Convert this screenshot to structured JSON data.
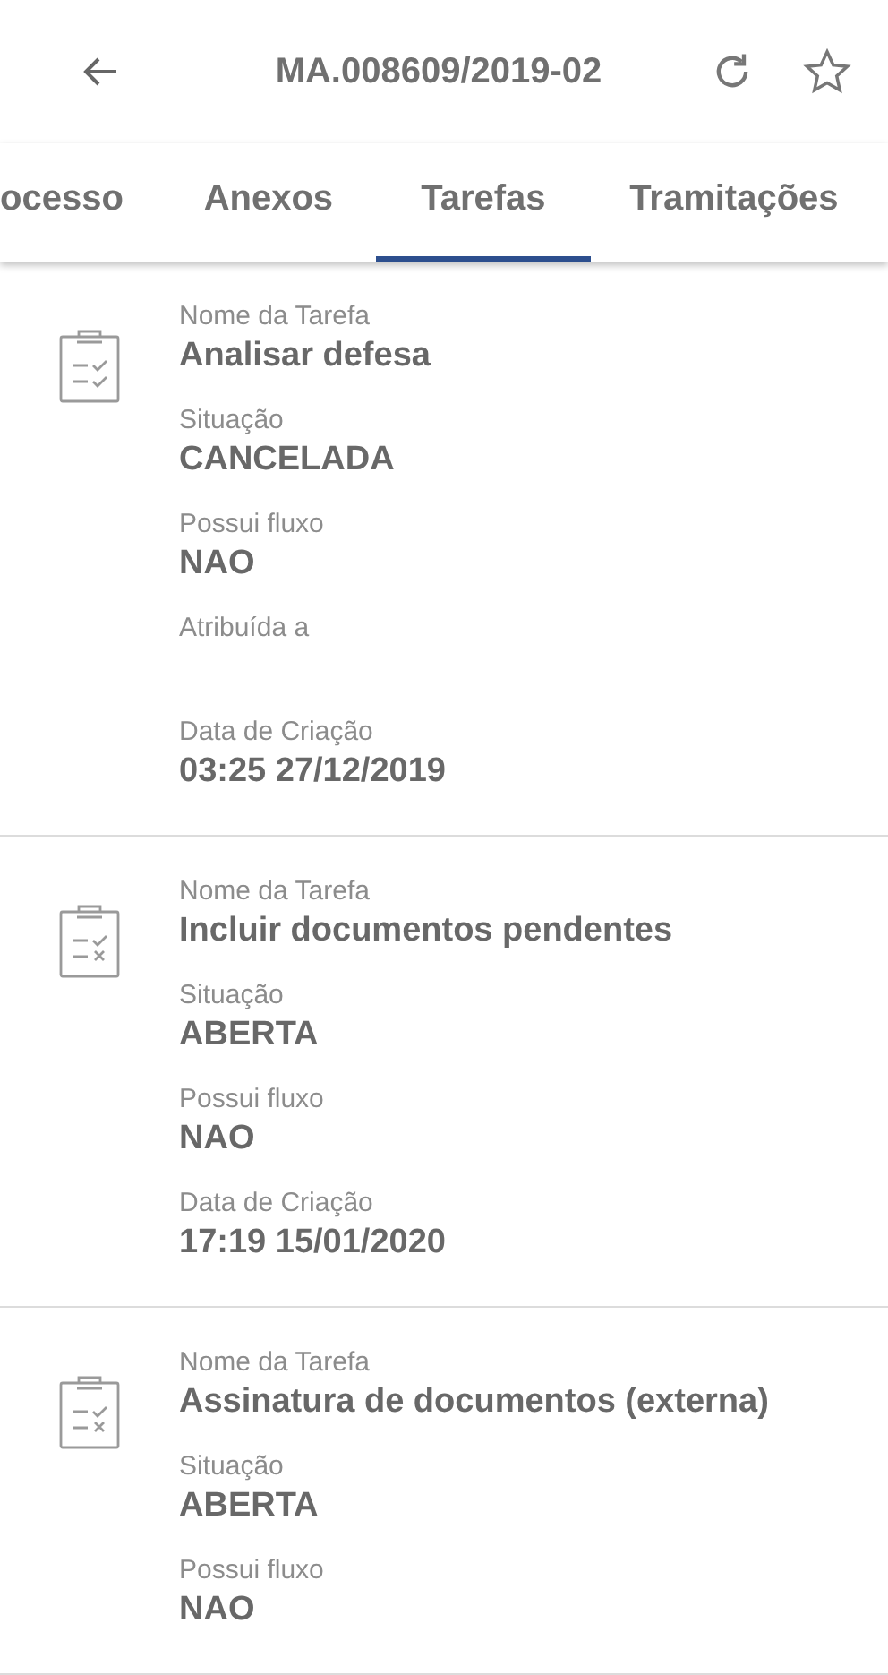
{
  "header": {
    "title": "MA.008609/2019-02"
  },
  "tabs": [
    {
      "label": "ocesso",
      "selected": false
    },
    {
      "label": "Anexos",
      "selected": false
    },
    {
      "label": "Tarefas",
      "selected": true
    },
    {
      "label": "Tramitações",
      "selected": false
    }
  ],
  "tasks": [
    {
      "kind": "complete",
      "fields": [
        {
          "label": "Nome da Tarefa",
          "value": "Analisar defesa"
        },
        {
          "label": "Situação",
          "value": "CANCELADA"
        },
        {
          "label": "Possui fluxo",
          "value": "NAO"
        },
        {
          "label": "Atribuída a"
        },
        {
          "label": "Data de Criação",
          "value": "03:25 27/12/2019"
        }
      ]
    },
    {
      "kind": "incomplete",
      "fields": [
        {
          "label": "Nome da Tarefa",
          "value": "Incluir documentos pendentes"
        },
        {
          "label": "Situação",
          "value": "ABERTA"
        },
        {
          "label": "Possui fluxo",
          "value": "NAO"
        },
        {
          "label": "Data de Criação",
          "value": "17:19 15/01/2020"
        }
      ]
    },
    {
      "kind": "incomplete",
      "fields": [
        {
          "label": "Nome da Tarefa",
          "value": "Assinatura de documentos (externa)"
        },
        {
          "label": "Situação",
          "value": "ABERTA"
        },
        {
          "label": "Possui fluxo",
          "value": "NAO"
        }
      ]
    }
  ]
}
